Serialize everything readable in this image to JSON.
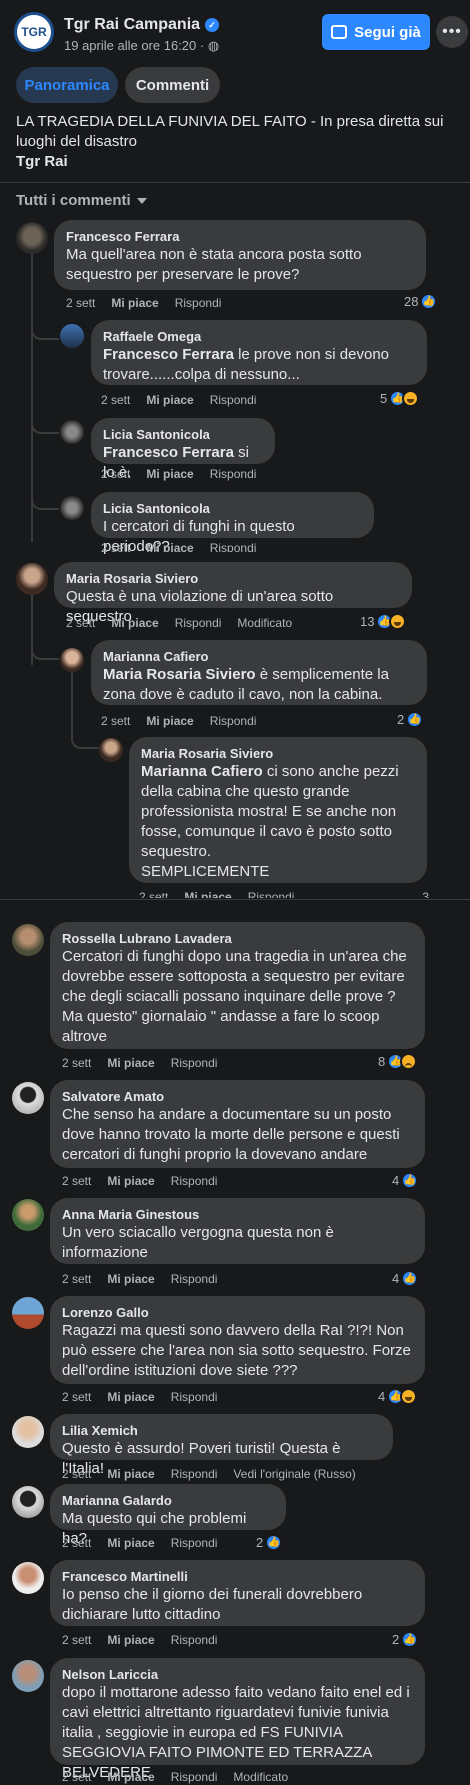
{
  "header": {
    "page_name": "Tgr Rai Campania",
    "avatar_text": "TGR",
    "date": "19 aprile alle ore 16:20 · ",
    "follow_label": "Segui già",
    "more": "•••"
  },
  "tabs": [
    {
      "label": "Panoramica"
    },
    {
      "label": "Commenti"
    }
  ],
  "post": {
    "text": "LA TRAGEDIA DELLA FUNIVIA DEL FAITO - In presa diretta sui luoghi del disastro",
    "author": "Tgr Rai"
  },
  "filter": {
    "label": "Tutti i commenti"
  },
  "labels": {
    "like": "Mi piace",
    "reply": "Rispondi",
    "edited": "Modificato",
    "translate": "Vedi l'originale (Russo)"
  },
  "comments": [
    {
      "name": "Francesco Ferrara",
      "text": "Ma quell'area non è stata ancora posta sotto sequestro per preservare le prove?",
      "time": "2 sett",
      "reactions": "28"
    },
    {
      "name": "Raffaele Omega",
      "mention": "Francesco Ferrara",
      "text": " le prove non si devono trovare......colpa di nessuno...",
      "time": "2 sett",
      "reactions": "5"
    },
    {
      "name": "Licia Santonicola",
      "mention": "Francesco Ferrara",
      "text": " si lo è.",
      "time": "2 sett"
    },
    {
      "name": "Licia Santonicola",
      "text": "I cercatori di funghi in questo periodo??",
      "time": "2 sett"
    },
    {
      "name": "Maria Rosaria Siviero",
      "text": "Questa è una violazione di un'area sotto sequestro",
      "time": "2 sett",
      "reactions": "13"
    },
    {
      "name": "Marianna Cafiero",
      "mention": "Maria Rosaria Siviero",
      "text": " è semplicemente la zona dove è caduto il cavo, non la cabina.",
      "time": "2 sett",
      "reactions": "2"
    },
    {
      "name": "Maria Rosaria Siviero",
      "mention": "Marianna Cafiero",
      "text": " ci sono anche pezzi della cabina che questo grande professionista mostra! E se anche non fosse, comunque il cavo è posto sotto sequestro.",
      "text2": "SEMPLICEMENTE",
      "time": "2 sett",
      "reactions": "3"
    },
    {
      "name": "Rossella Lubrano Lavadera",
      "text": "Cercatori di funghi dopo una tragedia in un'area che dovrebbe essere sottoposta a sequestro per evitare che degli sciacalli possano inquinare delle prove ? Ma questo\" giornalaio \" andasse a fare lo scoop altrove",
      "time": "2 sett",
      "reactions": "8"
    },
    {
      "name": "Salvatore Amato",
      "text": "Che senso ha andare a documentare su un posto dove hanno trovato la morte delle persone e questi cercatori di funghi proprio la dovevano andare",
      "time": "2 sett",
      "reactions": "4"
    },
    {
      "name": "Anna Maria Ginestous",
      "text": "Un vero sciacallo vergogna questa non è informazione",
      "time": "2 sett",
      "reactions": "4"
    },
    {
      "name": "Lorenzo Gallo",
      "text": "Ragazzi ma questi sono davvero della RaI ?!?! Non può essere che l'area non sia sotto sequestro. Forze dell'ordine istituzioni dove siete ???",
      "time": "2 sett",
      "reactions": "4"
    },
    {
      "name": "Lilia Xemich",
      "text": "Questo è assurdo! Poveri turisti! Questa è l'Italia!",
      "time": "2 sett"
    },
    {
      "name": "Marianna Galardo",
      "text": "Ma questo qui che problemi ha?",
      "time": "2 sett",
      "reactions": "2"
    },
    {
      "name": "Francesco Martinelli",
      "text": "Io penso che il giorno dei funerali dovrebbero dichiarare lutto cittadino",
      "time": "2 sett",
      "reactions": "2"
    },
    {
      "name": "Nelson Lariccia",
      "text": "dopo il mottarone adesso faito vedano faito enel ed i cavi elettrici altrettanto riguardatevi funivie funivia italia , seggiovie in europa ed FS FUNIVIA SEGGIOVIA FAITO PIMONTE ED TERRAZZA BELVEDERE",
      "time": "2 sett"
    }
  ],
  "colors": {
    "background": "#18191a",
    "bubble": "#3a3b3c",
    "accent": "#2d88ff",
    "text": "#e4e6eb",
    "muted": "#b0b3b8"
  },
  "icons": [
    "verified-icon",
    "globe-icon",
    "messenger-follow-icon",
    "chevron-down-icon",
    "like-icon",
    "haha-icon",
    "sad-icon"
  ]
}
